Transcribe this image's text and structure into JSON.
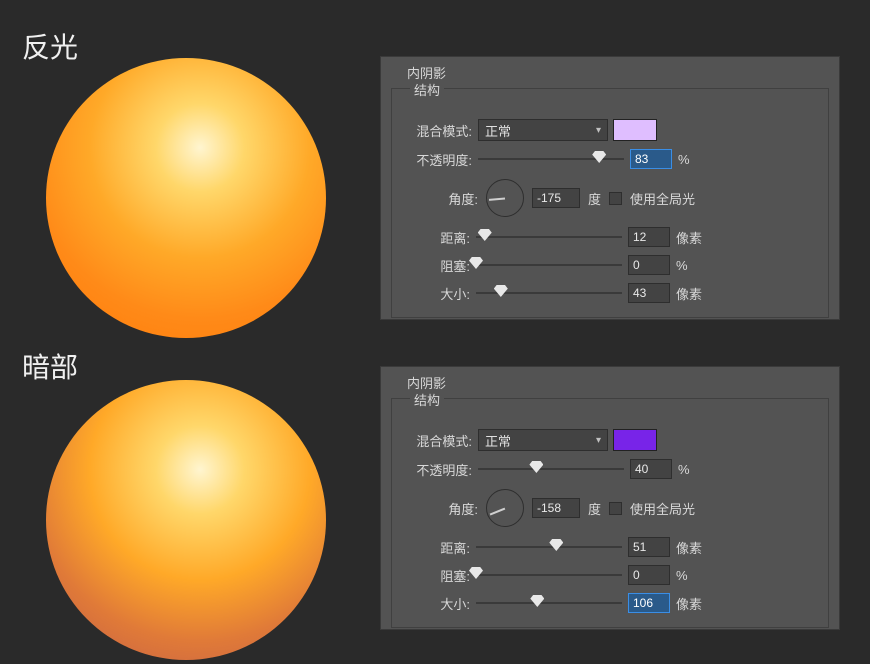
{
  "sections": {
    "top": {
      "label": "反光",
      "hex": "#dfbeff"
    },
    "bottom": {
      "label": "暗部",
      "hex": "#7824e8"
    }
  },
  "panel_top": {
    "title": "内阴影",
    "group": "结构",
    "blend_label": "混合模式:",
    "blend_value": "正常",
    "swatch_color": "#dfbeff",
    "opacity_label": "不透明度:",
    "opacity_value": "83",
    "opacity_unit": "%",
    "angle_label": "角度:",
    "angle_value": "-175",
    "angle_unit": "度",
    "global_light": "使用全局光",
    "distance_label": "距离:",
    "distance_value": "12",
    "distance_unit": "像素",
    "choke_label": "阻塞:",
    "choke_value": "0",
    "choke_unit": "%",
    "size_label": "大小:",
    "size_value": "43",
    "size_unit": "像素"
  },
  "panel_bottom": {
    "title": "内阴影",
    "group": "结构",
    "blend_label": "混合模式:",
    "blend_value": "正常",
    "swatch_color": "#7824e8",
    "opacity_label": "不透明度:",
    "opacity_value": "40",
    "opacity_unit": "%",
    "angle_label": "角度:",
    "angle_value": "-158",
    "angle_unit": "度",
    "global_light": "使用全局光",
    "distance_label": "距离:",
    "distance_value": "51",
    "distance_unit": "像素",
    "choke_label": "阻塞:",
    "choke_value": "0",
    "choke_unit": "%",
    "size_label": "大小:",
    "size_value": "106",
    "size_unit": "像素"
  }
}
